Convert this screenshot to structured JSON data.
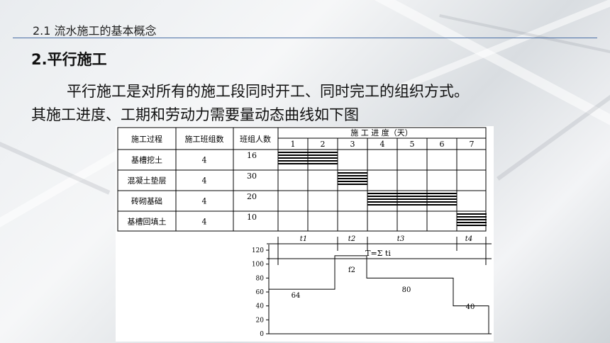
{
  "slide": {
    "section_title": "2.1 流水施工的基本概念",
    "subheading": "2.平行施工",
    "paragraph_line1": "平行施工是对所有的施工段同时开工、同时完工的组织方式。",
    "paragraph_line2": "其施工进度、工期和劳动力需要量动态曲线如下图"
  },
  "schedule_table": {
    "headers": {
      "process": "施工过程",
      "teams": "施工班组数",
      "workers": "班组人数",
      "progress": "施 工 进 度（天）"
    },
    "day_labels": [
      "1",
      "2",
      "3",
      "4",
      "5",
      "6",
      "7"
    ],
    "rows": [
      {
        "process": "基槽挖土",
        "teams": "4",
        "workers": "16",
        "start_day": 1,
        "end_day": 2
      },
      {
        "process": "混凝土垫层",
        "teams": "4",
        "workers": "30",
        "start_day": 3,
        "end_day": 3
      },
      {
        "process": "砖砌基础",
        "teams": "4",
        "workers": "20",
        "start_day": 4,
        "end_day": 6
      },
      {
        "process": "基槽回填土",
        "teams": "4",
        "workers": "10",
        "start_day": 7,
        "end_day": 7
      }
    ]
  },
  "duration_labels": {
    "t1": "t1",
    "t2": "t2",
    "t3": "t3",
    "t4": "t4",
    "total": "T=Σ ti"
  },
  "chart_data": {
    "type": "line",
    "title": "",
    "xlabel": "",
    "ylabel": "",
    "ylim": [
      0,
      120
    ],
    "y_ticks": [
      "0",
      "20",
      "40",
      "60",
      "80",
      "100",
      "120"
    ],
    "x": [
      0,
      2,
      3,
      6,
      7
    ],
    "series": [
      {
        "values": [
          64,
          112,
          80,
          40,
          0
        ]
      }
    ],
    "data_labels": [
      "64",
      "f2",
      "80",
      "40"
    ]
  }
}
